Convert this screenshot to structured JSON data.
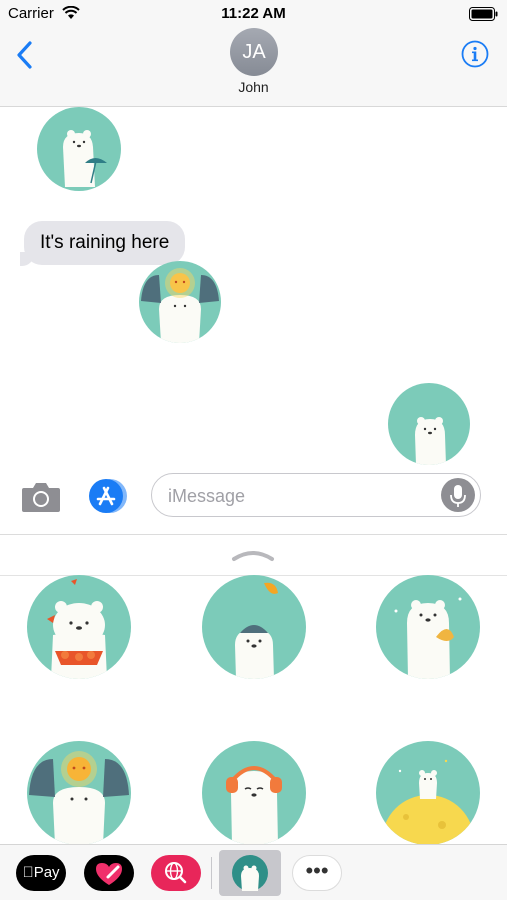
{
  "status_bar": {
    "carrier": "Carrier",
    "time": "11:22 AM"
  },
  "header": {
    "avatar_initials": "JA",
    "contact_name": "John"
  },
  "conversation": {
    "messages": [
      {
        "type": "sticker",
        "sender": "other",
        "sticker": "bear-umbrella"
      },
      {
        "type": "text",
        "sender": "other",
        "text": "It's raining here"
      },
      {
        "type": "sticker",
        "sender": "other",
        "sticker": "bear-sun-headphones"
      },
      {
        "type": "sticker",
        "sender": "me",
        "sticker": "bear-peek"
      }
    ]
  },
  "input_bar": {
    "placeholder": "iMessage"
  },
  "sticker_drawer": {
    "stickers": [
      "bear-autumn-leaves",
      "bear-beanie",
      "bear-fan",
      "bear-sun-headphones",
      "bear-orange-headphones",
      "bear-on-moon"
    ]
  },
  "app_strip": {
    "apple_pay_label": "Pay",
    "more_label": "•••"
  },
  "colors": {
    "ios_blue": "#1a7cf5",
    "sticker_teal": "#7ccbb9",
    "bubble_gray": "#e5e5ea",
    "search_app_pink": "#e8265a"
  }
}
